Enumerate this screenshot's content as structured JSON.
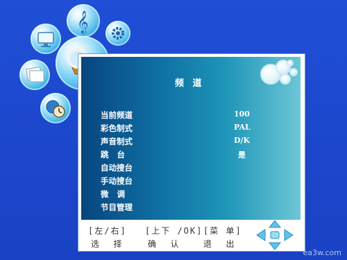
{
  "menu": {
    "title": "频 道",
    "items": [
      {
        "label": "当前频道",
        "value": "100"
      },
      {
        "label": "彩色制式",
        "value": "PAL"
      },
      {
        "label": "声音制式",
        "value": "D/K"
      },
      {
        "label": "跳   台",
        "value": "是"
      },
      {
        "label": "自动搜台",
        "value": ""
      },
      {
        "label": "手动搜台",
        "value": ""
      },
      {
        "label": "微   调",
        "value": ""
      },
      {
        "label": "节目管理",
        "value": ""
      }
    ]
  },
  "hints": {
    "keys": [
      "[左/右]",
      "[上下 /OK]",
      "[菜 单]"
    ],
    "actions": [
      "选  择",
      "确  认",
      "退  出"
    ]
  },
  "watermark": "ea3w.com",
  "icons": [
    "music-note-icon",
    "gear-icon",
    "monitor-icon",
    "search-film-icon",
    "photo-icon",
    "globe-clock-icon"
  ],
  "colors": {
    "background": "#1f4fd6",
    "accent": "#1d94b8"
  }
}
